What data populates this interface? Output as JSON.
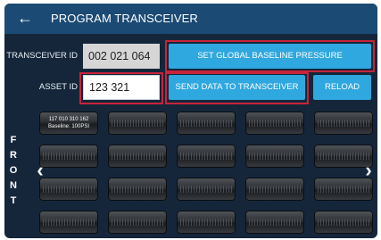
{
  "header": {
    "back_icon": "arrow-left-icon",
    "title": "PROGRAM TRANSCEIVER"
  },
  "form": {
    "transceiver_id_label": "TRANSCEIVER ID",
    "transceiver_id_value": "002 021 064",
    "asset_id_label": "ASSET ID",
    "asset_id_value": "123 321"
  },
  "buttons": {
    "set_baseline": "SET GLOBAL BASELINE PRESSURE",
    "send_data": "SEND DATA TO TRANSCEIVER",
    "reload": "RELOAD"
  },
  "front_label": [
    "F",
    "R",
    "O",
    "N",
    "T"
  ],
  "grid": {
    "first_tile_line1": "117 010 310 162",
    "first_tile_line2": "Baseline: 100PSI"
  },
  "navigation": {
    "prev_icon": "chevron-left-icon",
    "next_icon": "chevron-right-icon"
  },
  "colors": {
    "header": "#1b4a74",
    "background": "#15263a",
    "button": "#2fa7df",
    "highlight": "#c8243a"
  }
}
